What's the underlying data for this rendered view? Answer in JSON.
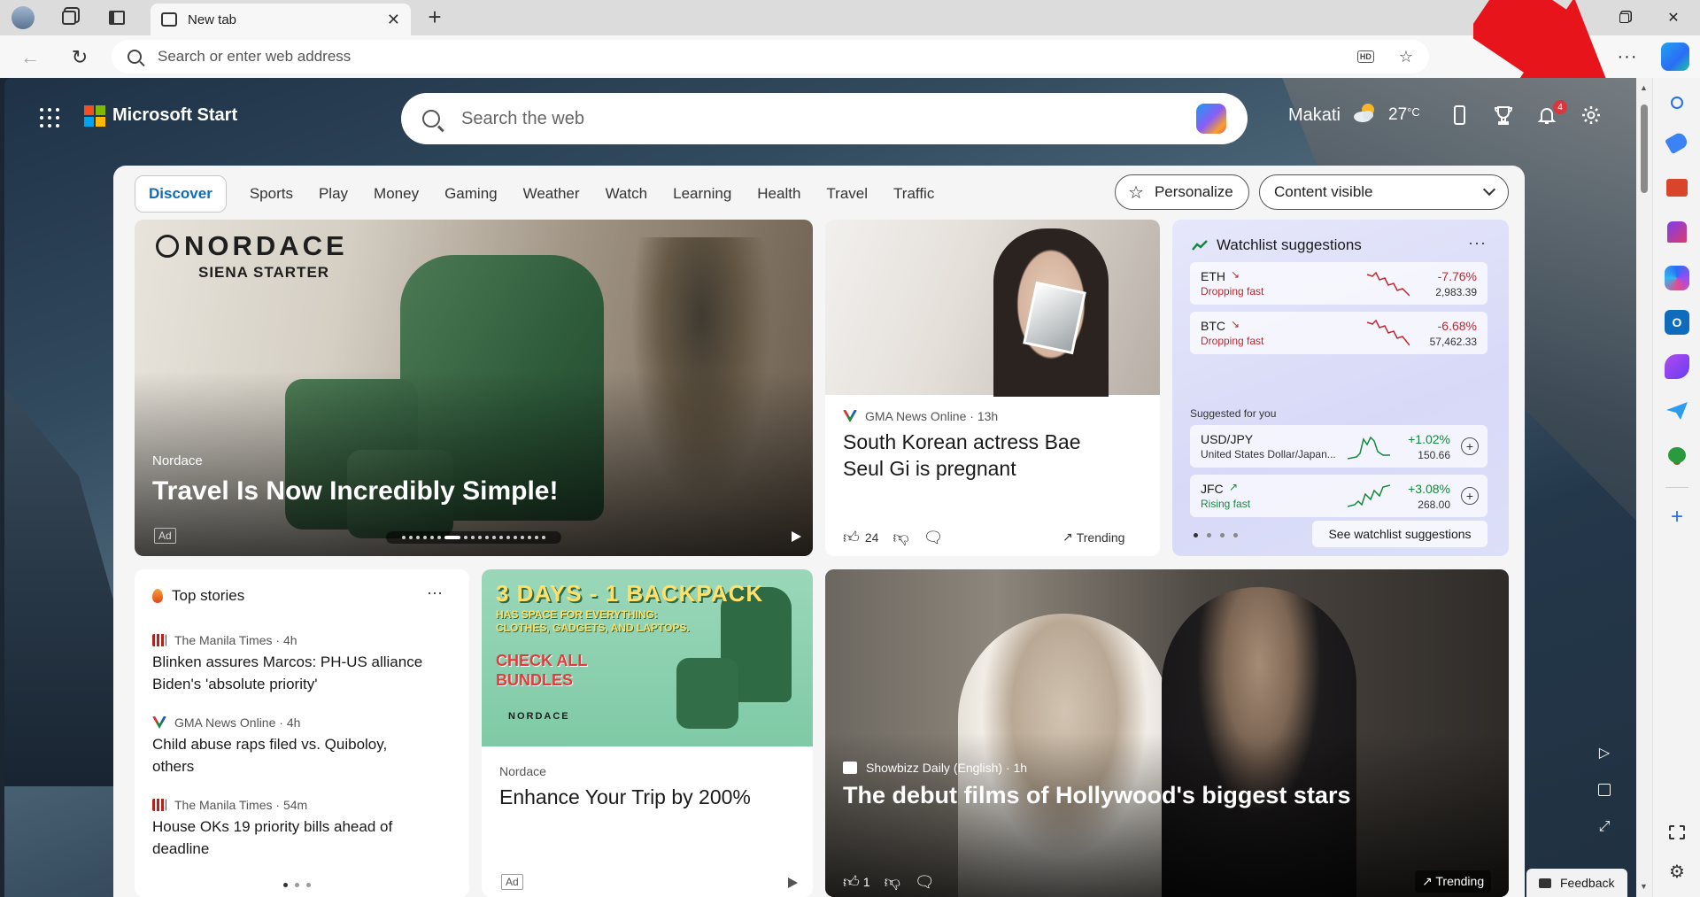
{
  "tab": {
    "title": "New tab",
    "close": "✕",
    "new": "+"
  },
  "addressbar": {
    "placeholder": "Search or enter web address",
    "hd": "HD",
    "more": "···"
  },
  "header": {
    "brand": "Microsoft Start",
    "search_placeholder": "Search the web",
    "location": "Makati",
    "temperature": "27",
    "temp_unit": "°C",
    "notification_count": "4"
  },
  "categories": [
    "Discover",
    "Sports",
    "Play",
    "Money",
    "Gaming",
    "Weather",
    "Watch",
    "Learning",
    "Health",
    "Travel",
    "Traffic"
  ],
  "personalize_label": "Personalize",
  "content_visibility": "Content visible",
  "hero": {
    "brand": "NORDACE",
    "brand_sub": "SIENA STARTER",
    "source": "Nordace",
    "title": "Travel Is Now Incredibly Simple!",
    "ad_label": "Ad"
  },
  "news1": {
    "source": "GMA News Online",
    "age": "13h",
    "title": "South Korean actress Bae Seul Gi is pregnant",
    "likes": "24",
    "trending_label": "Trending"
  },
  "watchlist": {
    "title": "Watchlist suggestions",
    "more": "···",
    "tickers": [
      {
        "symbol": "ETH",
        "desc": "Dropping fast",
        "change": "-7.76%",
        "price": "2,983.39"
      },
      {
        "symbol": "BTC",
        "desc": "Dropping fast",
        "change": "-6.68%",
        "price": "57,462.33"
      }
    ],
    "suggested_label": "Suggested for you",
    "suggested": [
      {
        "symbol": "USD/JPY",
        "desc": "United States Dollar/Japan...",
        "change": "+1.02%",
        "price": "150.66"
      },
      {
        "symbol": "JFC",
        "desc": "Rising fast",
        "change": "+3.08%",
        "price": "268.00"
      }
    ],
    "see_label": "See watchlist suggestions"
  },
  "top_stories": {
    "title": "Top stories",
    "more": "···",
    "items": [
      {
        "source": "The Manila Times",
        "age": "4h",
        "title": "Blinken assures Marcos: PH-US alliance Biden's 'absolute priority'"
      },
      {
        "source": "GMA News Online",
        "age": "4h",
        "title": "Child abuse raps filed vs. Quiboloy, others"
      },
      {
        "source": "The Manila Times",
        "age": "54m",
        "title": "House OKs 19 priority bills ahead of deadline"
      }
    ]
  },
  "adcard": {
    "headline": "3 DAYS - 1 BACKPACK",
    "subline": "HAS SPACE FOR EVERYTHING: CLOTHES, GADGETS, AND LAPTOPS.",
    "cta": "CHECK ALL BUNDLES",
    "logo": "NORDACE",
    "source": "Nordace",
    "title": "Enhance Your Trip by 200%",
    "ad_label": "Ad"
  },
  "bigstory": {
    "source": "Showbizz Daily (English)",
    "age": "1h",
    "title": "The debut films of Hollywood's biggest stars",
    "likes": "1",
    "trending_label": "Trending"
  },
  "feedback_label": "Feedback",
  "colors": {
    "accent": "#0f6cbd",
    "negative": "#c4262e",
    "positive": "#138a3a",
    "annotation_arrow": "#e8141b"
  }
}
